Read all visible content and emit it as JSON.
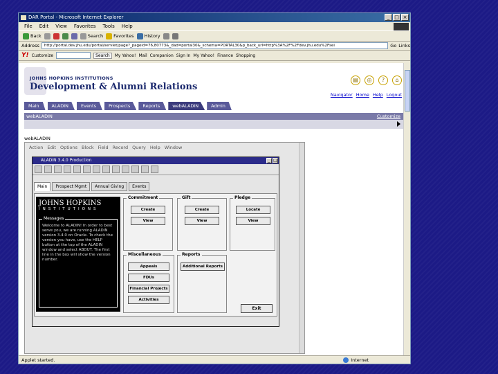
{
  "window": {
    "title": "DAR Portal - Microsoft Internet Explorer",
    "menu": [
      "File",
      "Edit",
      "View",
      "Favorites",
      "Tools",
      "Help"
    ],
    "toolbar": [
      "Back",
      "Search",
      "Favorites",
      "History"
    ],
    "address_label": "Address",
    "address_value": "http://portal.dev.jhu.edu/portal/servlet/page?_pageid=76,80773&_dad=portal30&_schema=PORTAL30&p_back_url=http%3A%2F%2Fdev.jhu.edu%2Fsei",
    "go": "Go",
    "links": "Links",
    "ybar": {
      "logo": "Y!",
      "customize": "Customize",
      "search": "Search",
      "items": [
        "My Yahoo!",
        "Mail",
        "Companion",
        "Sign In",
        "My Yahoo!",
        "Finance",
        "Shopping"
      ]
    },
    "status": "Applet started.",
    "zone": "Internet"
  },
  "portal": {
    "institution": "JOHNS HOPKINS INSTITUTIONS",
    "title": "Development & Alumni Relations",
    "toplinks": [
      "Navigator",
      "Home",
      "Help",
      "Logout"
    ],
    "icons": [
      "book-icon",
      "globe-icon",
      "help-icon",
      "home-icon"
    ],
    "tabs": [
      "Main",
      "ALADIN",
      "Events",
      "Prospects",
      "Reports",
      "webALADIN",
      "Admin"
    ],
    "active_tab": "webALADIN",
    "band_title": "webALADIN",
    "customize": "Customize",
    "applet_label": "webALADIN"
  },
  "applet": {
    "menu": [
      "Action",
      "Edit",
      "Options",
      "Block",
      "Field",
      "Record",
      "Query",
      "Help",
      "Window"
    ],
    "app_title": "ALADIN 3.4.0 Production",
    "tabs": [
      "Main",
      "Prospect Mgmt",
      "Annual Giving",
      "Events"
    ],
    "brand_line1": "JOHNS HOPKINS",
    "brand_line2": "INSTITUTIONS",
    "messages_title": "Messages",
    "messages_text": "Welcome to ALADIN! In order to best serve you, we are running ALADIN version 3.4.0 on Oracle. To check the version you have, use the HELP button at the top of the ALADIN window and select ABOUT. The first line in the box will show the version number.",
    "groups": {
      "commitment": {
        "title": "Commitment",
        "buttons": [
          "Create",
          "View"
        ]
      },
      "gift": {
        "title": "Gift",
        "buttons": [
          "Create",
          "View"
        ]
      },
      "pledge": {
        "title": "Pledge",
        "buttons": [
          "Locate",
          "View"
        ]
      },
      "misc": {
        "title": "Miscellaneous",
        "buttons": [
          "Appeals",
          "FDUs",
          "Financial Projects",
          "Activities"
        ]
      },
      "reports": {
        "title": "Reports",
        "buttons": [
          "Additional Reports"
        ]
      }
    },
    "exit": "Exit"
  }
}
